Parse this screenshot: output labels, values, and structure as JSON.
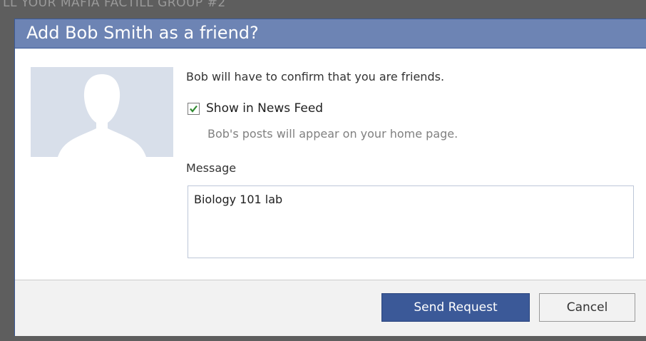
{
  "background": {
    "partial_text": "LL YOUR MAFIA FACTILL GROUP #2"
  },
  "dialog": {
    "title": "Add Bob Smith as a friend?",
    "confirm_text": "Bob will have to confirm that you are friends.",
    "show_in_feed": {
      "label": "Show in News Feed",
      "checked": true,
      "subtext": "Bob's posts will appear on your home page."
    },
    "message": {
      "label": "Message",
      "value": "Biology 101 lab"
    },
    "buttons": {
      "send": "Send Request",
      "cancel": "Cancel"
    }
  },
  "colors": {
    "title_bar": "#6d84b4",
    "primary_button": "#3b5998",
    "avatar_bg": "#d8dfea",
    "checkmark": "#2f8a2f"
  },
  "icons": {
    "avatar": "default-profile-silhouette-icon",
    "checkbox": "checkmark-icon"
  }
}
